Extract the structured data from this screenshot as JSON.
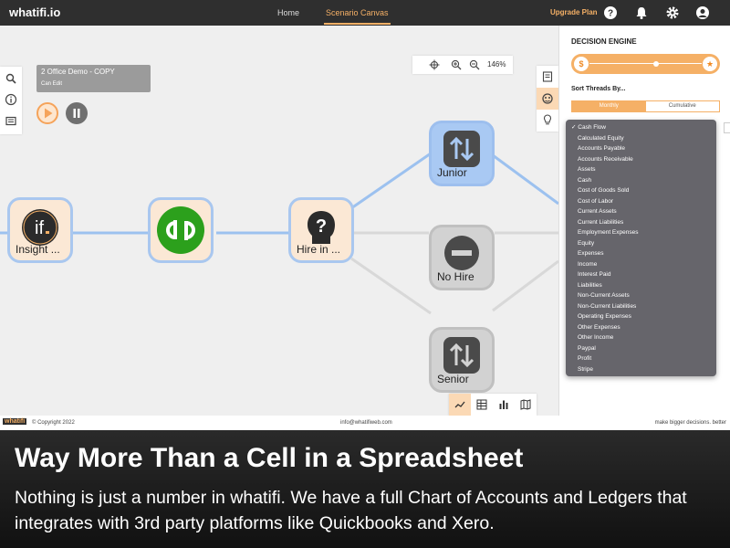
{
  "topbar": {
    "logo": "whatifi.io",
    "nav": [
      {
        "label": "Home"
      },
      {
        "label": "Scenario Canvas",
        "active": true
      }
    ],
    "upgrade_label": "Upgrade Plan",
    "icons": [
      "help-icon",
      "bell-icon",
      "gear-icon",
      "user-icon"
    ]
  },
  "canvas": {
    "scenario": {
      "name": "2 Office Demo - COPY",
      "permission": "Can Edit"
    },
    "zoom": "146%",
    "nodes": [
      {
        "id": "insight",
        "label": "Insight ...",
        "icon": "if-logo-icon"
      },
      {
        "id": "quickbooks",
        "label": "",
        "icon": "quickbooks-logo-icon"
      },
      {
        "id": "hire",
        "label": "Hire in ...",
        "icon": "question-head-icon"
      },
      {
        "id": "junior",
        "label": "Junior",
        "icon": "swap-vertical-icon"
      },
      {
        "id": "nohire",
        "label": "No Hire",
        "icon": "minus-circle-icon"
      },
      {
        "id": "senior",
        "label": "Senior",
        "icon": "swap-vertical-icon"
      }
    ]
  },
  "panel": {
    "heading": "DECISION ENGINE",
    "slider_left": "$",
    "slider_right": "★",
    "sort_label": "Sort Threads By...",
    "sort_options": [
      "Monthly",
      "Cumulative"
    ],
    "dropdown_items": [
      "Cash Flow",
      "Calculated Equity",
      "Accounts Payable",
      "Accounts Receivable",
      "Assets",
      "Cash",
      "Cost of Goods Sold",
      "Cost of Labor",
      "Current Assets",
      "Current Liabilities",
      "Employment Expenses",
      "Equity",
      "Expenses",
      "Income",
      "Interest Paid",
      "Liabilities",
      "Non-Current Assets",
      "Non-Current Liabilities",
      "Operating Expenses",
      "Other Expenses",
      "Other Income",
      "Paypal",
      "Profit",
      "Stripe"
    ],
    "selected_item": "Cash Flow"
  },
  "footer": {
    "logo": "whatifi",
    "copyright": "© Copyright 2022",
    "email": "info@whatifiweb.com",
    "tagline": "make bigger decisions. better"
  },
  "caption": {
    "headline": "Way More Than a Cell in a Spreadsheet",
    "body": "Nothing is just a number in whatifi. We have a full Chart of Accounts and Ledgers that integrates with 3rd party platforms like Quickbooks and Xero."
  },
  "colors": {
    "accent": "#f5b066",
    "node_border": "#a9c7ef",
    "dark": "#2f2f2f"
  }
}
